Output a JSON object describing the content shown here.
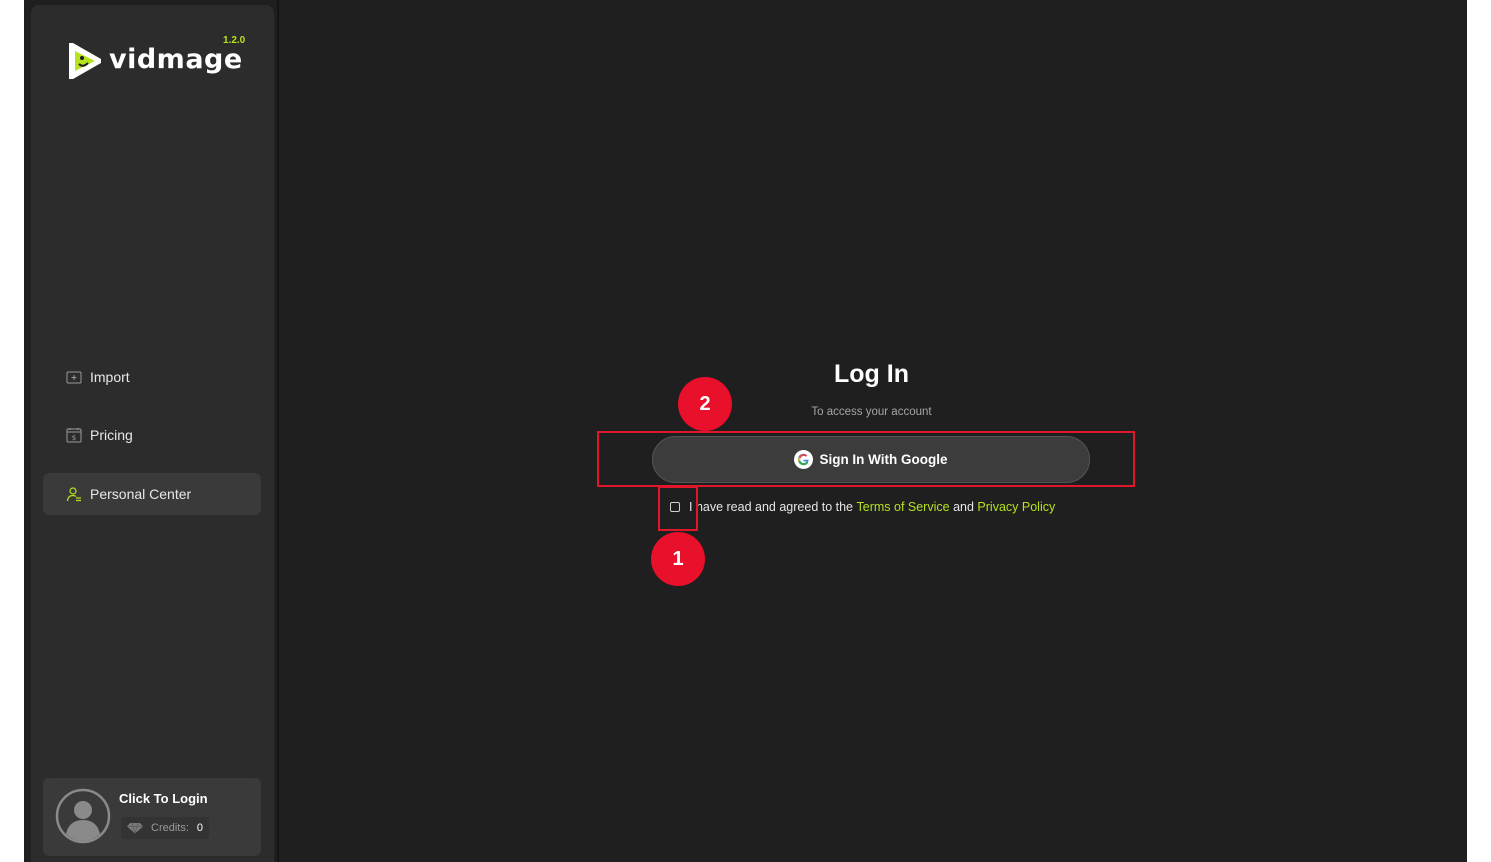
{
  "app": {
    "logo_text": "vidmage",
    "version": "1.2.0",
    "accent_color": "#b6e21f"
  },
  "sidebar": {
    "items": [
      {
        "label": "Import",
        "icon": "import-icon",
        "active": false
      },
      {
        "label": "Pricing",
        "icon": "pricing-icon",
        "active": false
      },
      {
        "label": "Personal Center",
        "icon": "user-icon",
        "active": true
      }
    ],
    "login_card": {
      "label": "Click To Login",
      "credits_label": "Credits:",
      "credits_value": "0"
    }
  },
  "login": {
    "title": "Log In",
    "subtitle": "To access your account",
    "google_button": "Sign In With Google",
    "agree_text": "I have read and agreed to the",
    "terms_link": "Terms of Service",
    "and_text": "and",
    "privacy_link": "Privacy Policy",
    "checkbox_checked": false
  },
  "annotations": {
    "marker_1": "1",
    "marker_2": "2",
    "highlight_color": "#e0172a"
  }
}
